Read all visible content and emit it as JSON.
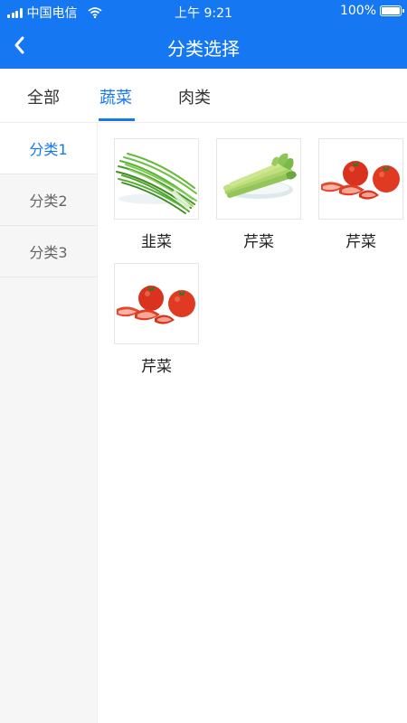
{
  "status_bar": {
    "carrier": "中国电信",
    "time": "上午 9:21",
    "battery": "100%",
    "battery_level": 1.0,
    "icons": [
      "signal-icon",
      "wifi-icon",
      "battery-icon"
    ]
  },
  "nav": {
    "title": "分类选择",
    "back_icon": "chevron-left-icon"
  },
  "tabs": [
    {
      "label": "全部"
    },
    {
      "label": "蔬菜",
      "active": true
    },
    {
      "label": "肉类"
    }
  ],
  "sidebar": {
    "items": [
      {
        "label": "分类1",
        "active": true
      },
      {
        "label": "分类2"
      },
      {
        "label": "分类3"
      }
    ]
  },
  "products": [
    {
      "name": "韭菜",
      "image": "chives"
    },
    {
      "name": "芹菜",
      "image": "celery"
    },
    {
      "name": "芹菜",
      "image": "tomatoes"
    },
    {
      "name": "芹菜",
      "image": "tomatoes"
    }
  ],
  "colors": {
    "accent": "#1677f2",
    "sidebar_bg": "#f6f6f6"
  }
}
